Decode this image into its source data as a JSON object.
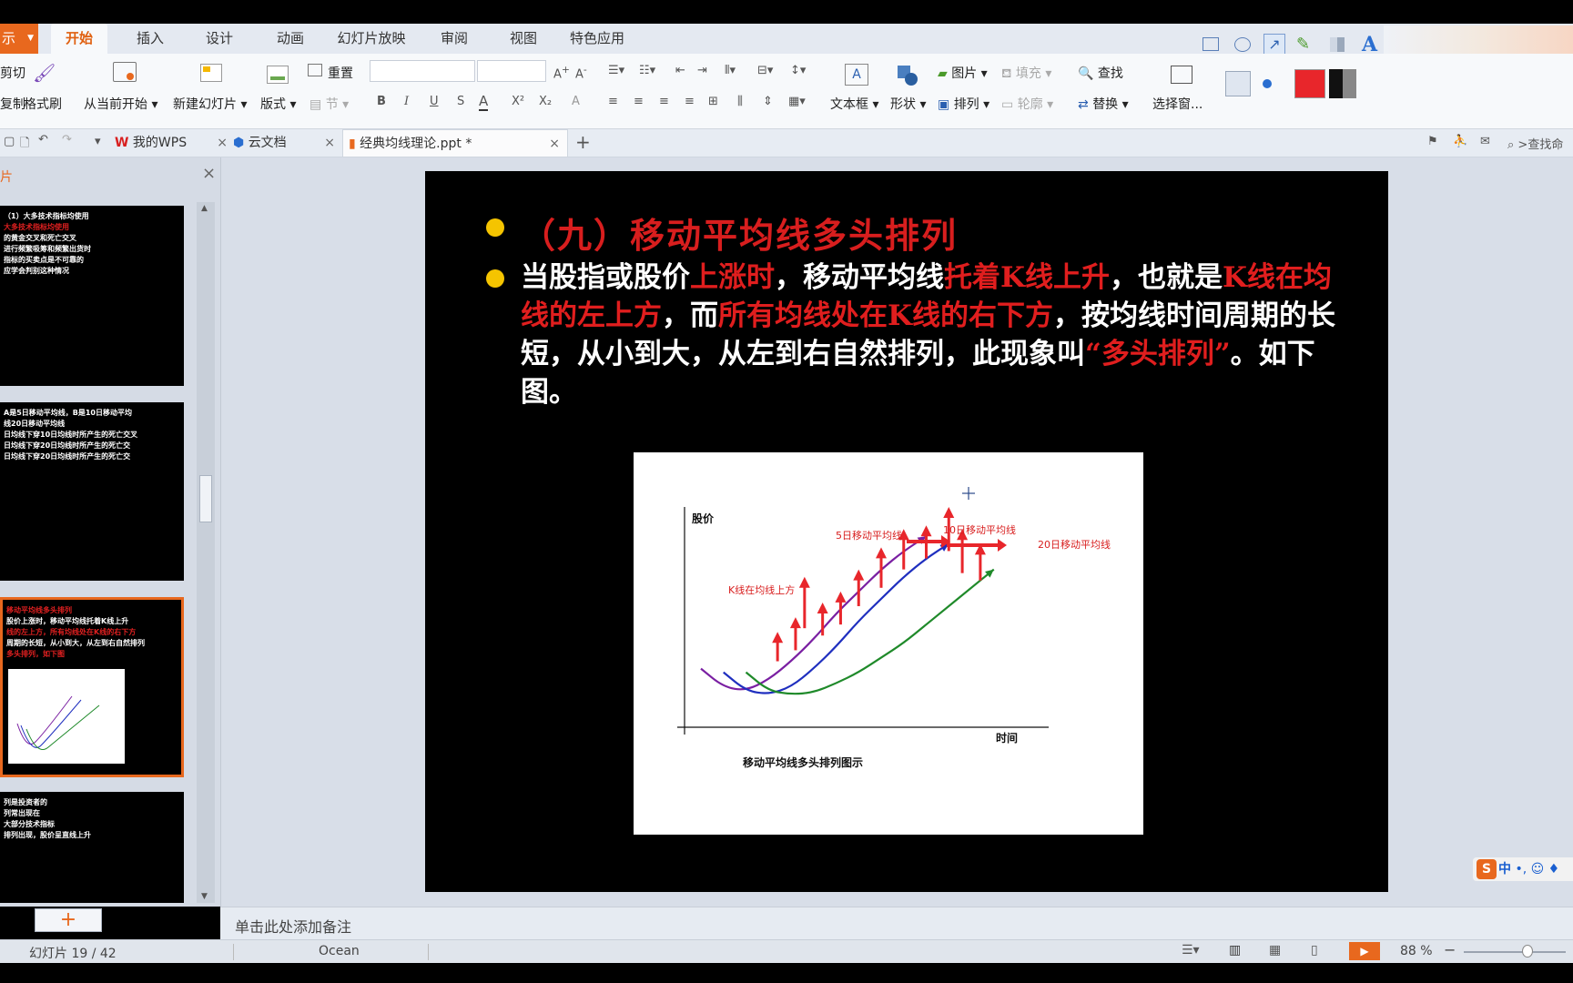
{
  "app_button": "示",
  "menu_tabs": [
    {
      "label": "开始",
      "active": true
    },
    {
      "label": "插入"
    },
    {
      "label": "设计"
    },
    {
      "label": "动画"
    },
    {
      "label": "幻灯片放映"
    },
    {
      "label": "审阅"
    },
    {
      "label": "视图"
    },
    {
      "label": "特色应用"
    }
  ],
  "ribbon": {
    "cut": "剪切",
    "copy": "复制",
    "format_painter": "格式刷",
    "from_current": "从当前开始",
    "new_slide": "新建幻灯片",
    "layout": "版式",
    "reset": "重置",
    "section": "节",
    "textbox": "文本框",
    "shape": "形状",
    "picture": "图片",
    "arrange": "排列",
    "fill": "填充",
    "outline": "轮廓",
    "find": "查找",
    "replace": "替换",
    "select_pane": "选择窗..."
  },
  "doc_tabs": [
    {
      "label": "我的WPS"
    },
    {
      "label": "云文档"
    },
    {
      "label": "经典均线理论.ppt *",
      "active": true
    }
  ],
  "search_cmd": ">查找命",
  "thumbnails": [
    {
      "lines": [
        "（1）大多技术指标均使用",
        "大多技术指标均使用",
        "的黄金交叉和死亡交叉",
        "进行频繁吸筹和频繁出货时",
        "指标的买卖点是不可靠的",
        "应学会判别这种情况"
      ]
    },
    {
      "lines": [
        "A是5日移动平均线，B是10日移动平均",
        "线20日移动平均线",
        "日均线下穿10日均线时所产生的死亡交叉",
        "日均线下穿20日均线时所产生的死亡交",
        "日均线下穿20日均线时所产生的死亡交"
      ]
    },
    {
      "lines": [
        "移动平均线多头排列",
        "股价上涨时，移动平均线托着K线上升",
        "线的左上方，所有均线处在K线的右下方",
        "周期的长短，从小到大，从左到右自然排列",
        "多头排列，如下图"
      ]
    },
    {
      "lines": [
        "列是投资者的",
        "列常出现在",
        "大部分技术指标",
        "排列出现，股价呈直线上升"
      ]
    }
  ],
  "slide": {
    "title": "（九）移动平均线多头排列",
    "body_parts": [
      {
        "text": "当股指或股价",
        "red": false
      },
      {
        "text": "上涨时",
        "red": true
      },
      {
        "text": "，移动平均线",
        "red": false
      },
      {
        "text": "托着K线上升",
        "red": true
      },
      {
        "text": "，也就是",
        "red": false
      },
      {
        "text": "K线在均线的左上方",
        "red": true
      },
      {
        "text": "，而",
        "red": false
      },
      {
        "text": "所有均线处在K线的右下方",
        "red": true
      },
      {
        "text": "，按均线时间周期的长短，从小到大，从左到右自然排列，此现象叫",
        "red": false
      },
      {
        "text": "“多头排列”",
        "red": true
      },
      {
        "text": "。如下图。",
        "red": false
      }
    ]
  },
  "chart_data": {
    "type": "line",
    "title": "",
    "caption": "移动平均线多头排列图示",
    "ylabel": "股价",
    "xlabel": "时间",
    "annotations": [
      "5日移动平均线",
      "10日移动平均线",
      "20日移动平均线",
      "K线在均线上方"
    ],
    "series": [
      {
        "name": "5日移动平均线",
        "color": "#7a1fa2",
        "x": [
          0,
          1,
          2,
          3,
          4,
          5,
          6,
          7,
          8,
          9,
          10
        ],
        "y": [
          22,
          12,
          10,
          16,
          26,
          38,
          52,
          64,
          76,
          86,
          94
        ]
      },
      {
        "name": "10日移动平均线",
        "color": "#1f2fbf",
        "x": [
          1,
          2,
          3,
          4,
          5,
          6,
          7,
          8,
          9,
          10,
          11
        ],
        "y": [
          20,
          10,
          8,
          12,
          22,
          34,
          48,
          60,
          72,
          82,
          90
        ]
      },
      {
        "name": "20日移动平均线",
        "color": "#1f8a2a",
        "x": [
          2,
          3,
          4,
          5,
          6,
          7,
          8,
          9,
          10,
          11,
          12,
          13
        ],
        "y": [
          20,
          10,
          8,
          9,
          14,
          20,
          28,
          36,
          46,
          56,
          66,
          76
        ]
      }
    ],
    "grid": false,
    "legend": "none"
  },
  "notes_placeholder": "单击此处添加备注",
  "status": {
    "slide_counter": "幻灯片 19 / 42",
    "theme": "Ocean",
    "zoom": "88 %"
  },
  "ime": "中"
}
